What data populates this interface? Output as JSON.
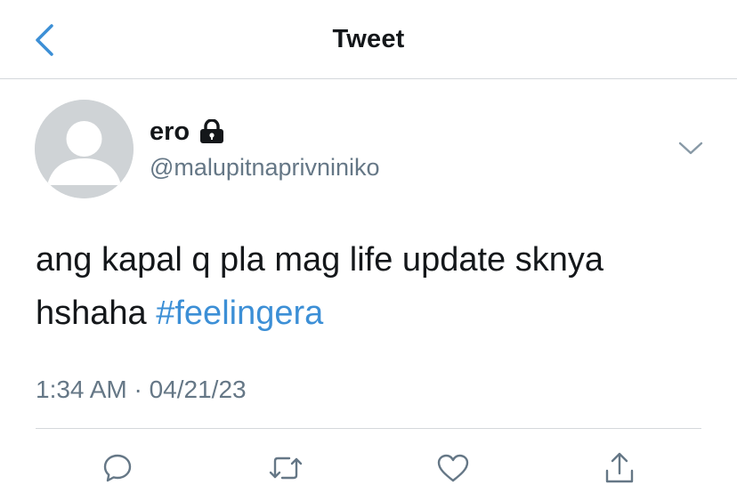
{
  "nav": {
    "title": "Tweet",
    "back_icon": "chevron-left-icon",
    "accent_color": "#3c8fd6"
  },
  "author": {
    "display_name": "ero",
    "handle": "@malupitnaprivniniko",
    "protected_icon": "lock-icon",
    "avatar": "default-avatar"
  },
  "tweet": {
    "text_before": "ang kapal q pla mag life update sknya hshaha ",
    "hashtag": "#feelingera",
    "timestamp": "1:34 AM · 04/21/23"
  },
  "actions": [
    {
      "icon": "reply-icon"
    },
    {
      "icon": "retweet-icon"
    },
    {
      "icon": "like-icon"
    },
    {
      "icon": "share-icon"
    }
  ]
}
